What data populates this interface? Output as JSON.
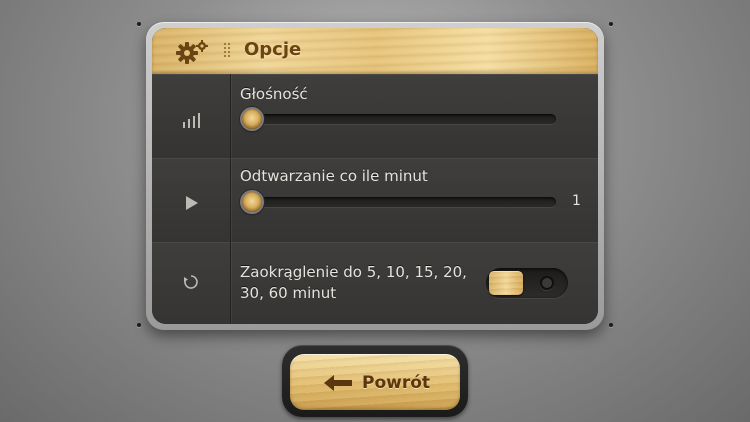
{
  "header": {
    "title": "Opcje",
    "icons": [
      "gear-icon",
      "grip-icon"
    ]
  },
  "settings": {
    "volume": {
      "label": "Głośność",
      "icon": "signal-bars-icon",
      "value_fraction": 0.0
    },
    "play_interval": {
      "label": "Odtwarzanie co ile minut",
      "icon": "play-icon",
      "value": "1",
      "value_fraction": 0.0
    },
    "rounding": {
      "label_line1": "Zaokrąglenie do 5, 10, 15, 20,",
      "label_line2": "30, 60 minut",
      "icon": "circle-arrow-icon",
      "enabled": false
    }
  },
  "footer": {
    "back_label": "Powrót",
    "back_icon": "arrow-left-icon"
  },
  "colors": {
    "wood": "#e6c47c",
    "panel": "#3b3a39",
    "text_light": "#e6e3de",
    "text_wood": "#6b4413"
  }
}
